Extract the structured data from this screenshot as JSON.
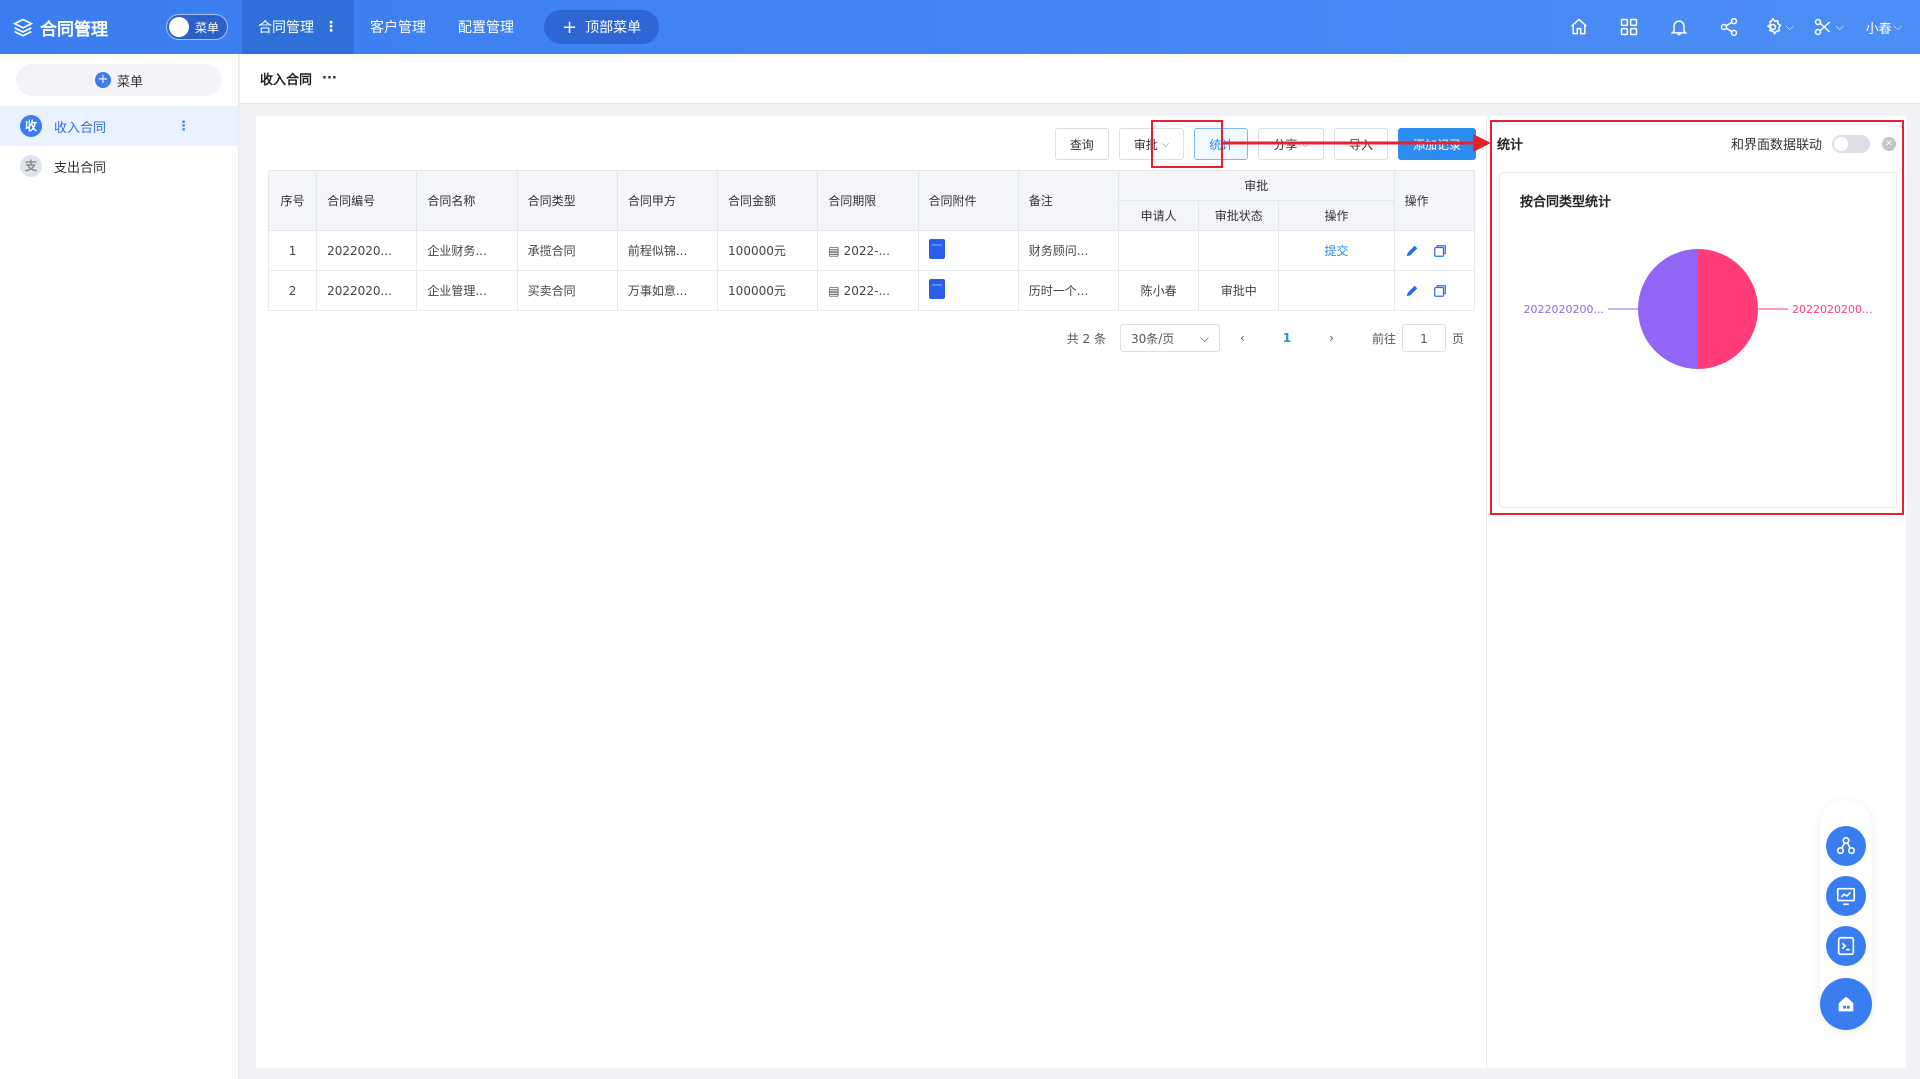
{
  "app": {
    "title": "合同管理",
    "menu_toggle": "菜单",
    "logo_icon": "layers-icon"
  },
  "top_tabs": [
    {
      "label": "合同管理",
      "active": true
    },
    {
      "label": "客户管理",
      "active": false
    },
    {
      "label": "配置管理",
      "active": false
    }
  ],
  "top_add_label": "顶部菜单",
  "top_icons": [
    "home-icon",
    "apps-icon",
    "bell-icon",
    "share-icon",
    "settings-icon",
    "tools-icon"
  ],
  "user": {
    "name": "小春"
  },
  "sidebar": {
    "menu_button": "菜单",
    "items": [
      {
        "badge": "收",
        "label": "收入合同",
        "active": true
      },
      {
        "badge": "支",
        "label": "支出合同",
        "active": false
      }
    ]
  },
  "breadcrumb": {
    "title": "收入合同",
    "more": "···"
  },
  "toolbar": {
    "query": "查询",
    "approve": "审批",
    "stats": "统计",
    "share": "分享",
    "import": "导入",
    "add": "添加记录"
  },
  "table": {
    "headers": {
      "seq": "序号",
      "code": "合同编号",
      "name": "合同名称",
      "type": "合同类型",
      "party_a": "合同甲方",
      "amount": "合同金额",
      "period": "合同期限",
      "attachment": "合同附件",
      "remark": "备注",
      "approval": "审批",
      "applicant": "申请人",
      "status": "审批状态",
      "approval_op": "操作",
      "op": "操作"
    },
    "rows": [
      {
        "seq": "1",
        "code": "2022020...",
        "name": "企业财务...",
        "type": "承揽合同",
        "party_a": "前程似锦...",
        "amount": "100000元",
        "period": "2022-...",
        "remark": "财务顾问...",
        "applicant": "",
        "status": "",
        "approval_op": "提交"
      },
      {
        "seq": "2",
        "code": "2022020...",
        "name": "企业管理...",
        "type": "买卖合同",
        "party_a": "万事如意...",
        "amount": "100000元",
        "period": "2022-...",
        "remark": "历时一个...",
        "applicant": "陈小春",
        "status": "审批中",
        "approval_op": ""
      }
    ]
  },
  "pager": {
    "total": "共 2 条",
    "page_size": "30条/页",
    "current": "1",
    "goto": "前往",
    "goto_value": "1",
    "page_unit": "页"
  },
  "stats_panel": {
    "title": "统计",
    "linkage_label": "和界面数据联动",
    "chart_title": "按合同类型统计"
  },
  "chart_data": {
    "type": "pie",
    "title": "按合同类型统计",
    "slices": [
      {
        "label": "2022020200...",
        "value": 50,
        "color": "#ff3c78"
      },
      {
        "label": "2022020200...",
        "value": 50,
        "color": "#9166f5"
      }
    ]
  },
  "colors": {
    "primary": "#2d8cf0",
    "topbar": "#3a7df0",
    "annotation_red": "#e8202b"
  },
  "floating_buttons": [
    "workflow-icon",
    "dashboard-icon",
    "terminal-icon",
    "home-building-icon"
  ]
}
